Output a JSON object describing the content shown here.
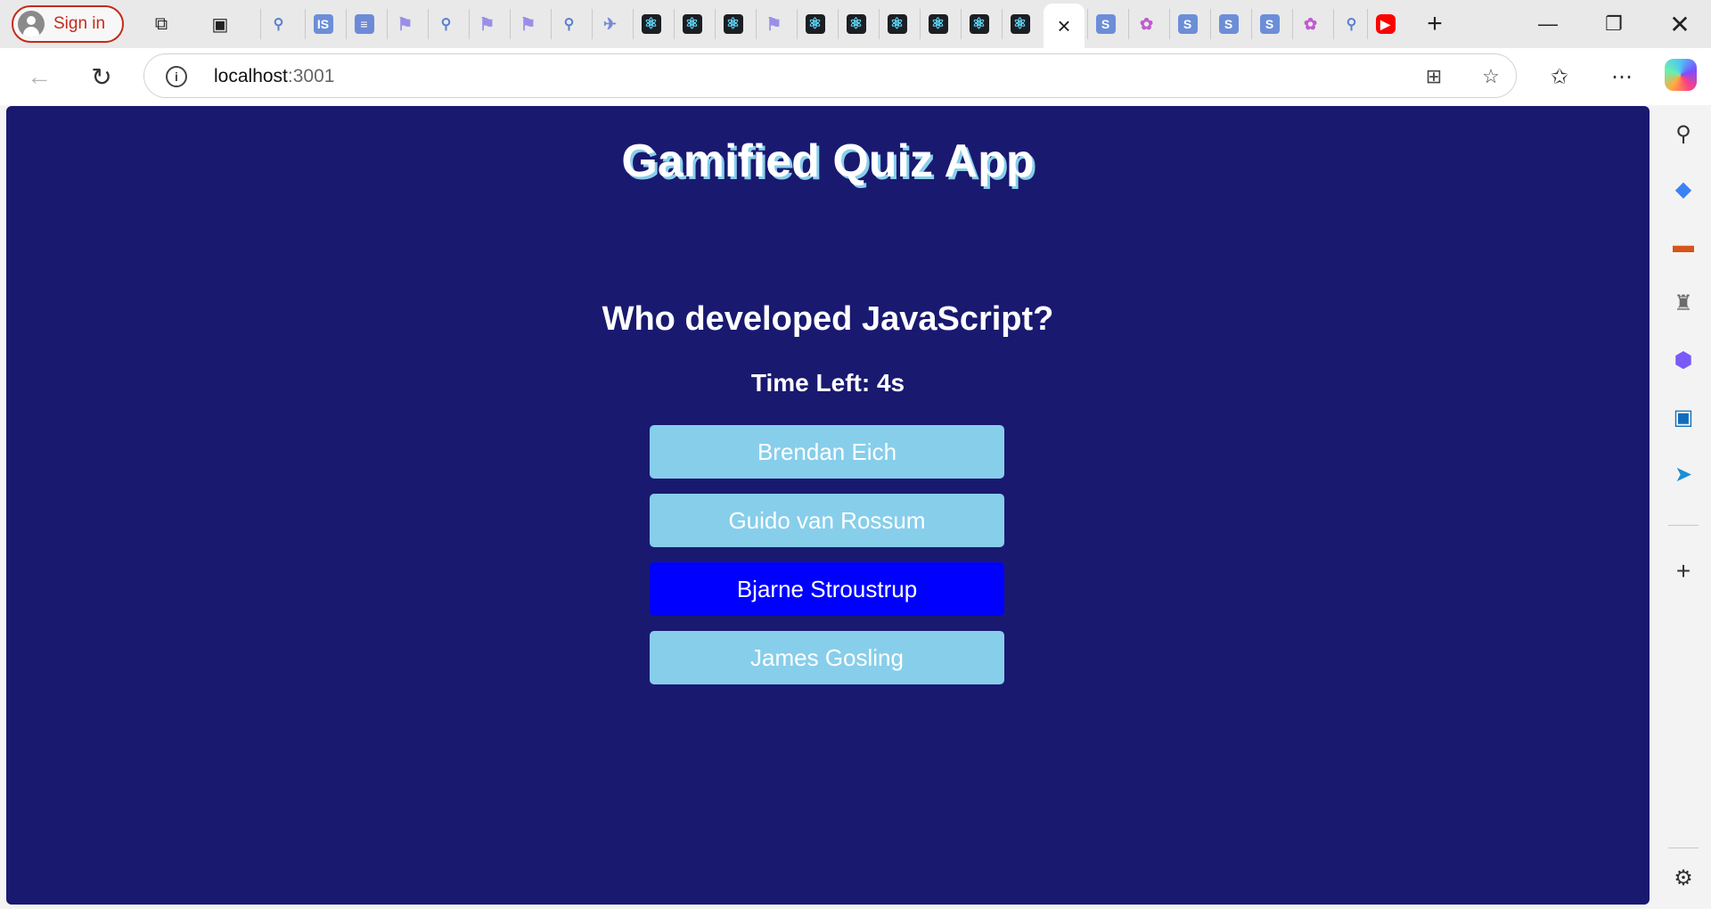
{
  "browser": {
    "signin_label": "Sign in",
    "active_tab_close": "×",
    "new_tab": "+",
    "url_host": "localhost",
    "url_port": ":3001"
  },
  "app": {
    "title": "Gamified Quiz App",
    "question": "Who developed JavaScript?",
    "timer_text": "Time Left: 4s",
    "options": [
      {
        "label": "Brendan Eich",
        "selected": false
      },
      {
        "label": "Guido van Rossum",
        "selected": false
      },
      {
        "label": "Bjarne Stroustrup",
        "selected": true
      },
      {
        "label": "James Gosling",
        "selected": false
      }
    ]
  },
  "colors": {
    "page_background": "#191970",
    "option_default": "#87ceeb",
    "option_selected": "#0000ff",
    "title_shadow": "#87ceeb"
  }
}
